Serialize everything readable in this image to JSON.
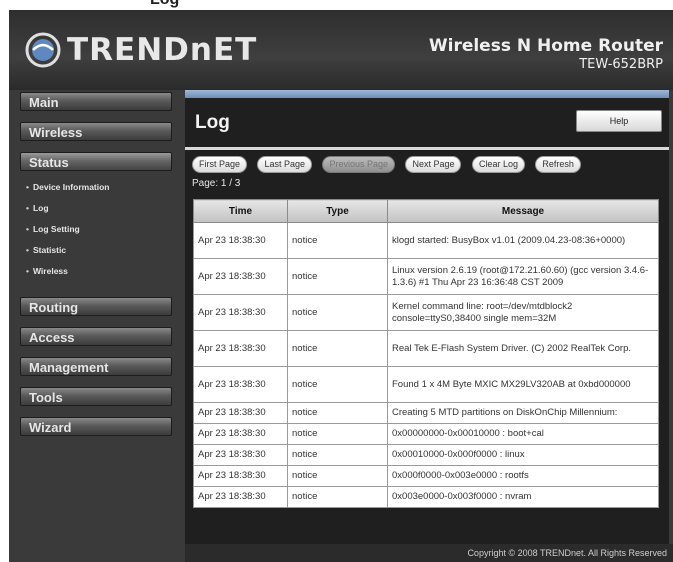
{
  "page_top_text": "Log",
  "header": {
    "logo_text": "TRENDnET",
    "product_title": "Wireless N Home Router",
    "product_model": "TEW-652BRP"
  },
  "sidebar": {
    "items": [
      {
        "label": "Main"
      },
      {
        "label": "Wireless"
      },
      {
        "label": "Status"
      },
      {
        "label": "Routing"
      },
      {
        "label": "Access"
      },
      {
        "label": "Management"
      },
      {
        "label": "Tools"
      },
      {
        "label": "Wizard"
      }
    ],
    "status_submenu": [
      {
        "label": "Device Information"
      },
      {
        "label": "Log"
      },
      {
        "label": "Log Setting"
      },
      {
        "label": "Statistic"
      },
      {
        "label": "Wireless"
      }
    ]
  },
  "content": {
    "title": "Log",
    "help_label": "Help",
    "actions": [
      "First Page",
      "Last Page",
      "Previous Page",
      "Next Page",
      "Clear Log",
      "Refresh"
    ],
    "page_indicator": "Page: 1 / 3",
    "table": {
      "headers": [
        "Time",
        "Type",
        "Message"
      ],
      "rows": [
        {
          "time": "Apr 23 18:38:30",
          "type": "notice",
          "message": "klogd started: BusyBox v1.01 (2009.04.23-08:36+0000)"
        },
        {
          "time": "Apr 23 18:38:30",
          "type": "notice",
          "message": "Linux version 2.6.19 (root@172.21.60.60) (gcc version 3.4.6-1.3.6) #1 Thu Apr 23 16:36:48 CST 2009"
        },
        {
          "time": "Apr 23 18:38:30",
          "type": "notice",
          "message": "Kernel command line: root=/dev/mtdblock2 console=ttyS0,38400 single mem=32M"
        },
        {
          "time": "Apr 23 18:38:30",
          "type": "notice",
          "message": "Real Tek E-Flash System Driver. (C) 2002 RealTek Corp."
        },
        {
          "time": "Apr 23 18:38:30",
          "type": "notice",
          "message": "Found 1 x 4M Byte MXIC MX29LV320AB at 0xbd000000"
        },
        {
          "time": "Apr 23 18:38:30",
          "type": "notice",
          "message": "Creating 5 MTD partitions on DiskOnChip Millennium:"
        },
        {
          "time": "Apr 23 18:38:30",
          "type": "notice",
          "message": "0x00000000-0x00010000 : boot+cal"
        },
        {
          "time": "Apr 23 18:38:30",
          "type": "notice",
          "message": "0x00010000-0x000f0000 : linux"
        },
        {
          "time": "Apr 23 18:38:30",
          "type": "notice",
          "message": "0x000f0000-0x003e0000 : rootfs"
        },
        {
          "time": "Apr 23 18:38:30",
          "type": "notice",
          "message": "0x003e0000-0x003f0000 : nvram"
        }
      ]
    }
  },
  "footer": {
    "copyright": "Copyright © 2008 TRENDnet. All Rights Reserved"
  },
  "colors": {
    "frame": "#3a3a3a",
    "accent_bar": "#7f9cc3",
    "panel": "#1f1f1f"
  }
}
